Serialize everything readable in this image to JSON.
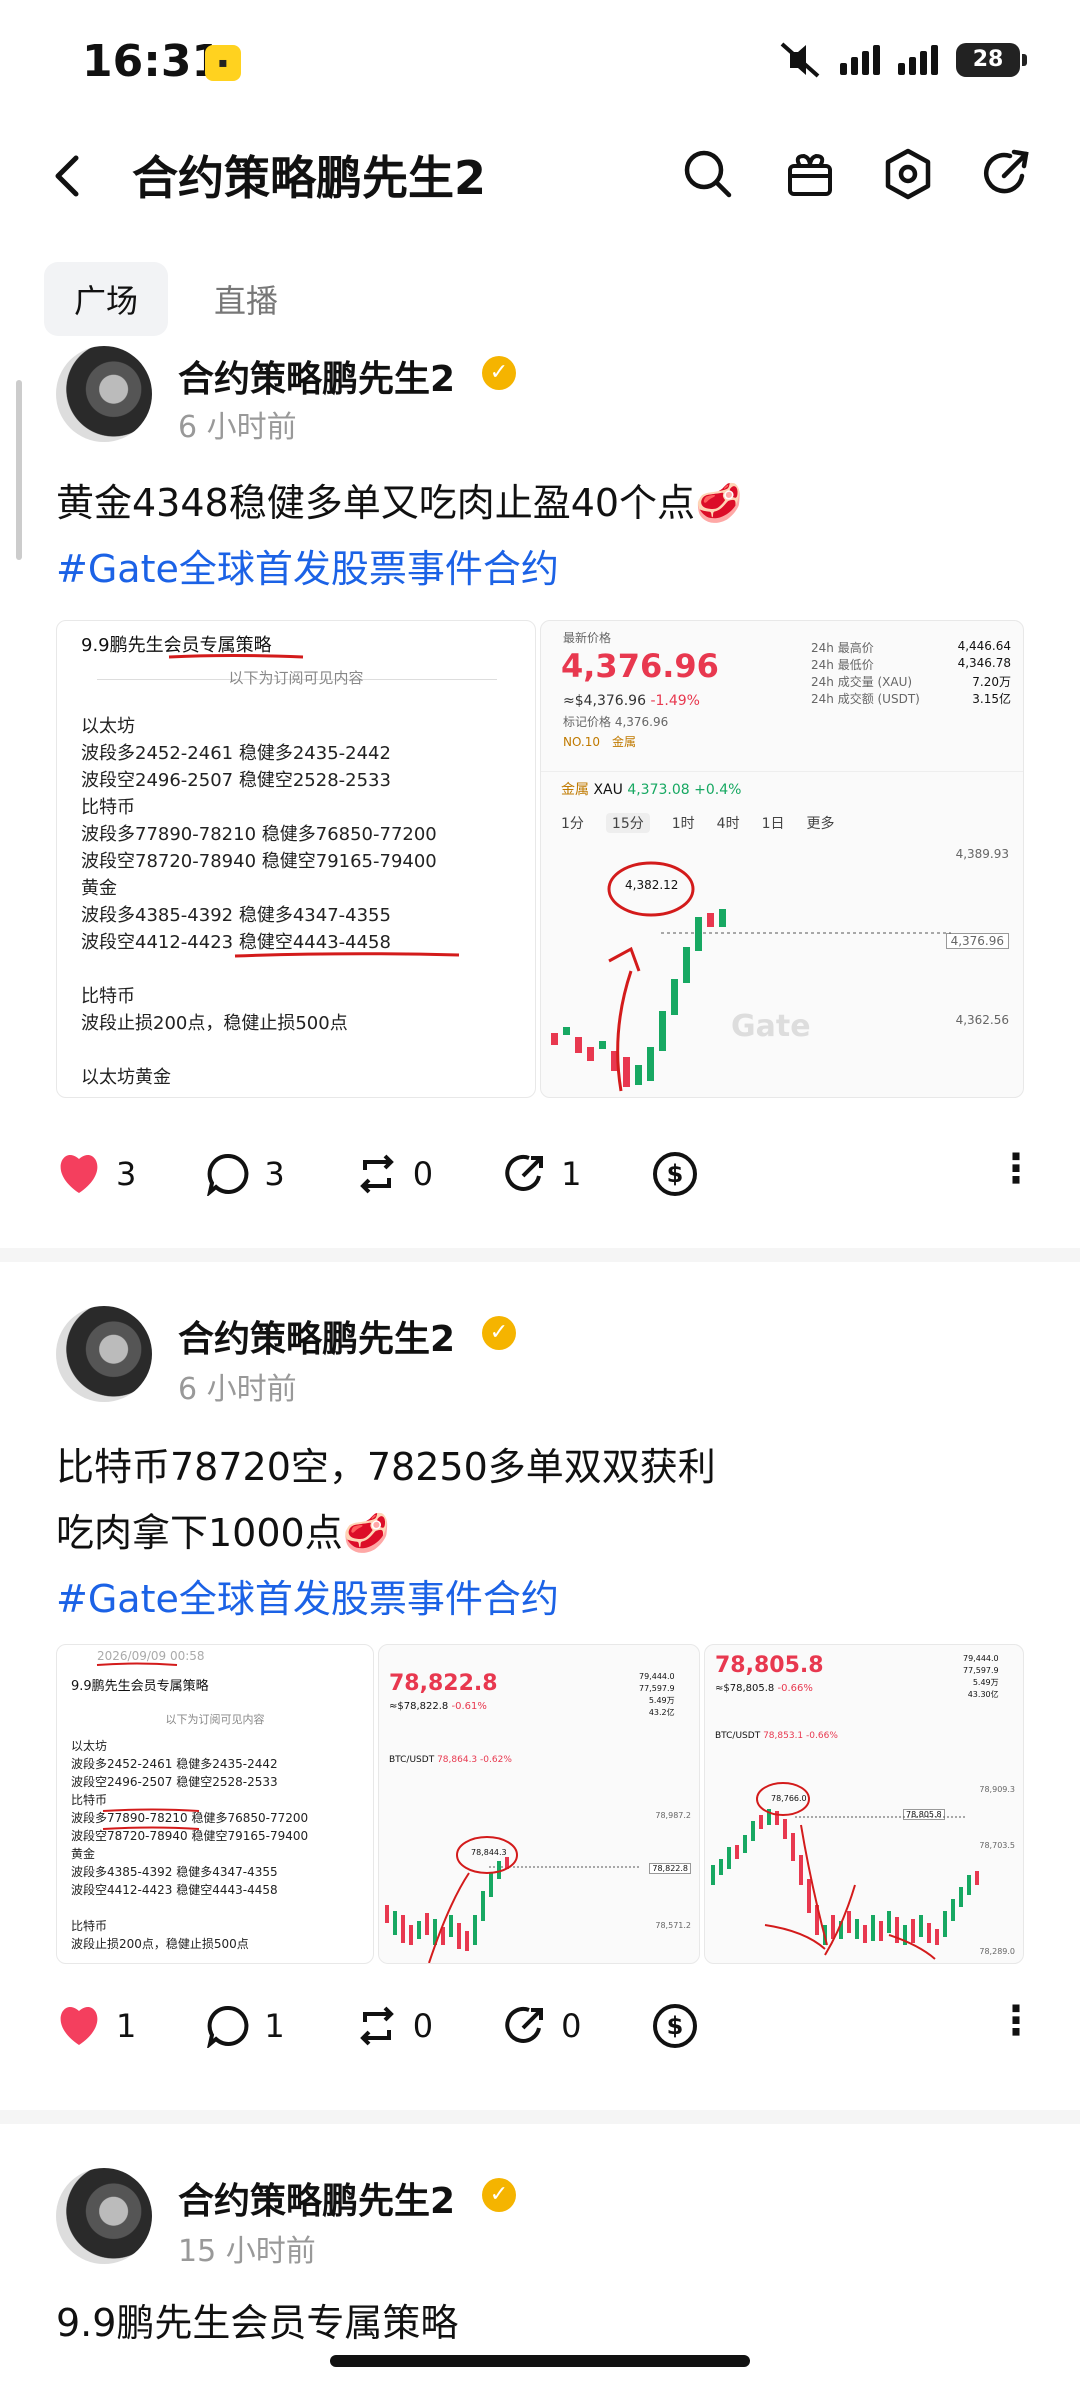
{
  "status": {
    "time": "16:31",
    "battery": "28"
  },
  "header": {
    "title": "合约策略鹏先生2"
  },
  "tabs": [
    "广场",
    "直播"
  ],
  "posts": [
    {
      "author": "合约策略鹏先生2",
      "time": "6 小时前",
      "text_line1": "黄金4348稳健多单又吃肉止盈40个点🥩",
      "hashtag": "#Gate全球首发股票事件合约",
      "doc": {
        "title": "9.9鹏先生会员专属策略",
        "subtitle": "以下为订阅可见内容",
        "body": "以太坊\n波段多2452-2461 稳健多2435-2442\n波段空2496-2507 稳健空2528-2533\n比特币\n波段多77890-78210 稳健多76850-77200\n波段空78720-78940 稳健空79165-79400\n黄金\n波段多4385-4392 稳健多4347-4355\n波段空4412-4423 稳健空4443-4458\n\n比特币\n波段止损200点，稳健止损500点\n\n以太坊黄金"
      },
      "chart": {
        "latest_label": "最新价格",
        "price": "4,376.96",
        "sub": "≈$4,376.96",
        "change": "-1.49%",
        "mark": "标记价格 4,376.96",
        "rank": "NO.10",
        "cat": "金属",
        "stats": [
          [
            "24h 最高价",
            "4,446.64"
          ],
          [
            "24h 最低价",
            "4,346.78"
          ],
          [
            "24h 成交量 (XAU)",
            "7.20万"
          ],
          [
            "24h 成交额 (USDT)",
            "3.15亿"
          ]
        ],
        "pair_cat": "金属",
        "pair": "XAU",
        "pair_price": "4,373.08",
        "pair_change": "+0.4%",
        "intervals": [
          "1分",
          "15分",
          "1时",
          "4时",
          "1日",
          "更多"
        ],
        "y_top": "4,389.93",
        "y_mid": "4,362.56",
        "hi_label": "4,382.12",
        "cur_label": "4,376.96",
        "watermark": "Gate"
      },
      "likes": "3",
      "comments": "3",
      "reposts": "0",
      "shares": "1"
    },
    {
      "author": "合约策略鹏先生2",
      "time": "6 小时前",
      "text_line1": "比特币78720空，78250多单双双获利",
      "text_line2": "吃肉拿下1000点🥩",
      "hashtag": "#Gate全球首发股票事件合约",
      "doc": {
        "date": "2026/09/09 00:58",
        "title": "9.9鹏先生会员专属策略",
        "subtitle": "以下为订阅可见内容",
        "body": "以太坊\n波段多2452-2461 稳健多2435-2442\n波段空2496-2507 稳健空2528-2533\n比特币\n波段多77890-78210 稳健多76850-77200\n波段空78720-78940 稳健空79165-79400\n黄金\n波段多4385-4392 稳健多4347-4355\n波段空4412-4423 稳健空4443-4458\n\n比特币\n波段止损200点，稳健止损500点"
      },
      "chart2": {
        "price": "78,822.8",
        "sub": "≈$78,822.8",
        "change": "-0.61%",
        "pair": "BTC/USDT",
        "pair_price": "78,864.3",
        "pair_change": "-0.62%",
        "stats": [
          "79,444.0",
          "77,597.9",
          "5.49万",
          "43.2亿"
        ],
        "y_top": "78,987.2",
        "y_bot": "78,571.2",
        "hi": "78,844.3",
        "cur": "78,822.8"
      },
      "chart3": {
        "price": "78,805.8",
        "sub": "≈$78,805.8",
        "change": "-0.66%",
        "pair": "BTC/USDT",
        "pair_price": "78,853.1",
        "pair_change": "-0.66%",
        "stats": [
          "79,444.0",
          "77,597.9",
          "5.49万",
          "43.30亿"
        ],
        "y_top": "78,909.3",
        "y_mid": "78,703.5",
        "y_bot": "78,289.0",
        "hi": "78,766.0",
        "cur": "78,805.8"
      },
      "likes": "1",
      "comments": "1",
      "reposts": "0",
      "shares": "0"
    },
    {
      "author": "合约策略鹏先生2",
      "time": "15 小时前",
      "text_line1": "9.9鹏先生会员专属策略"
    }
  ],
  "icons": [
    "back-arrow-icon",
    "search-icon",
    "gift-icon",
    "settings-hex-icon",
    "share-arrow-icon",
    "heart-icon",
    "comment-icon",
    "repost-icon",
    "share-icon",
    "tip-dollar-icon",
    "more-icon",
    "verified-icon"
  ],
  "colors": {
    "accent_blue": "#1b62e6",
    "like_red": "#f43f5e",
    "price_red": "#e8384f",
    "up_green": "#17a862",
    "verified_gold": "#f5b400"
  }
}
